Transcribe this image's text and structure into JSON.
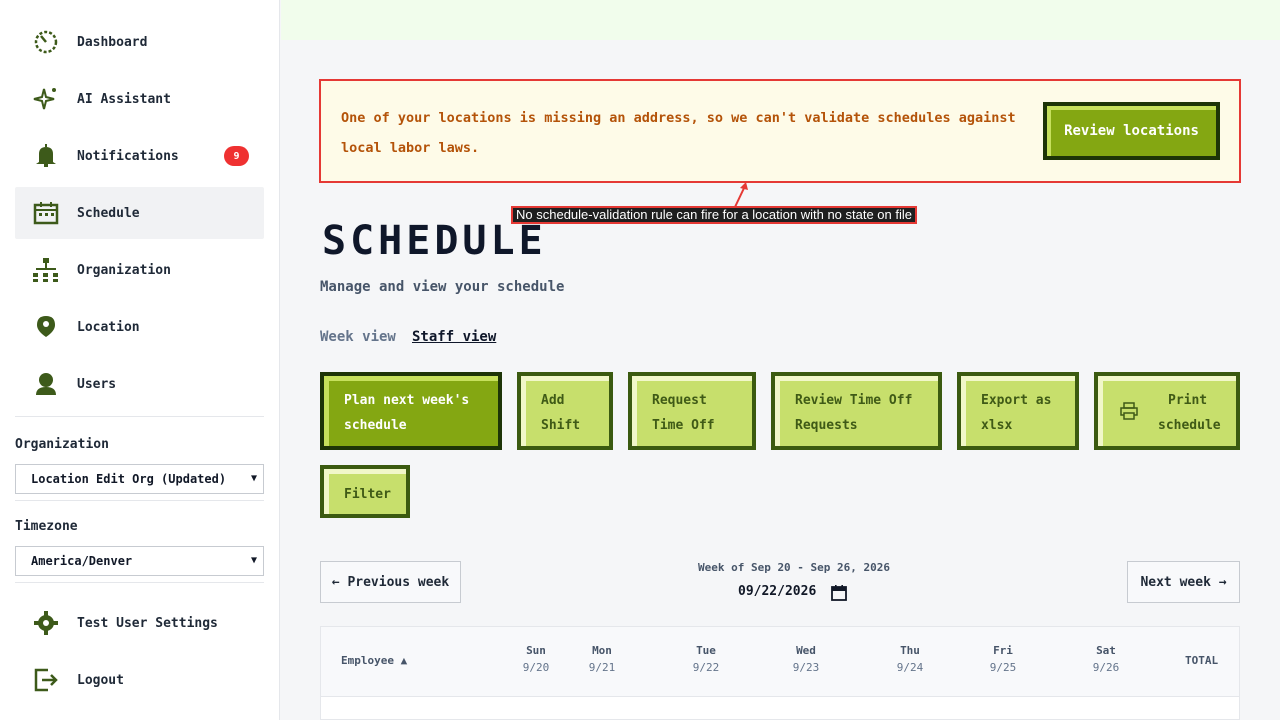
{
  "sidebar": {
    "items": [
      {
        "label": "Dashboard",
        "icon": "dashboard-icon"
      },
      {
        "label": "AI Assistant",
        "icon": "sparkle-icon"
      },
      {
        "label": "Notifications",
        "icon": "bell-icon",
        "badge": "9"
      },
      {
        "label": "Schedule",
        "icon": "calendar-icon"
      },
      {
        "label": "Organization",
        "icon": "org-chart-icon"
      },
      {
        "label": "Location",
        "icon": "location-pin-icon"
      },
      {
        "label": "Users",
        "icon": "user-icon"
      },
      {
        "label": "Test User Settings",
        "icon": "gear-icon"
      },
      {
        "label": "Logout",
        "icon": "logout-icon"
      }
    ],
    "organization_label": "Organization",
    "organization_value": "Location Edit Org (Updated)",
    "timezone_label": "Timezone",
    "timezone_value": "America/Denver"
  },
  "alert": {
    "text": "One of your locations is missing an address, so we can't validate schedules against local labor laws.",
    "button": "Review locations"
  },
  "tooltip": "No schedule-validation rule can fire for a location with no state on file",
  "page": {
    "title": "SCHEDULE",
    "subtitle": "Manage and view your schedule",
    "tabs": [
      "Week view",
      "Staff view"
    ]
  },
  "actions": {
    "plan_line1": "Plan next week's",
    "plan_line2": "schedule",
    "add_line1": "Add",
    "add_line2": "Shift",
    "req_line1": "Request",
    "req_line2": "Time Off",
    "review_line1": "Review Time Off",
    "review_line2": "Requests",
    "export_line1": "Export as",
    "export_line2": "xlsx",
    "print_line1": "Print",
    "print_line2": "schedule",
    "filter": "Filter"
  },
  "week_nav": {
    "prev": "← Previous week",
    "next": "Next week →",
    "week_of": "Week of Sep 20 - Sep 26, 2026",
    "date_value": "09/22/2026"
  },
  "table": {
    "employee_header": "Employee ▲",
    "days": [
      {
        "day": "Sun",
        "date": "9/20"
      },
      {
        "day": "Mon",
        "date": "9/21"
      },
      {
        "day": "Tue",
        "date": "9/22"
      },
      {
        "day": "Wed",
        "date": "9/23"
      },
      {
        "day": "Thu",
        "date": "9/24"
      },
      {
        "day": "Fri",
        "date": "9/25"
      },
      {
        "day": "Sat",
        "date": "9/26"
      }
    ],
    "total_header": "TOTAL"
  },
  "colors": {
    "primary_green": "#84a712",
    "light_green": "#c7df6c",
    "dark_green_border": "#1d3407",
    "alert_red": "#e53935",
    "alert_text": "#b45309",
    "badge_red": "#ef3131"
  }
}
